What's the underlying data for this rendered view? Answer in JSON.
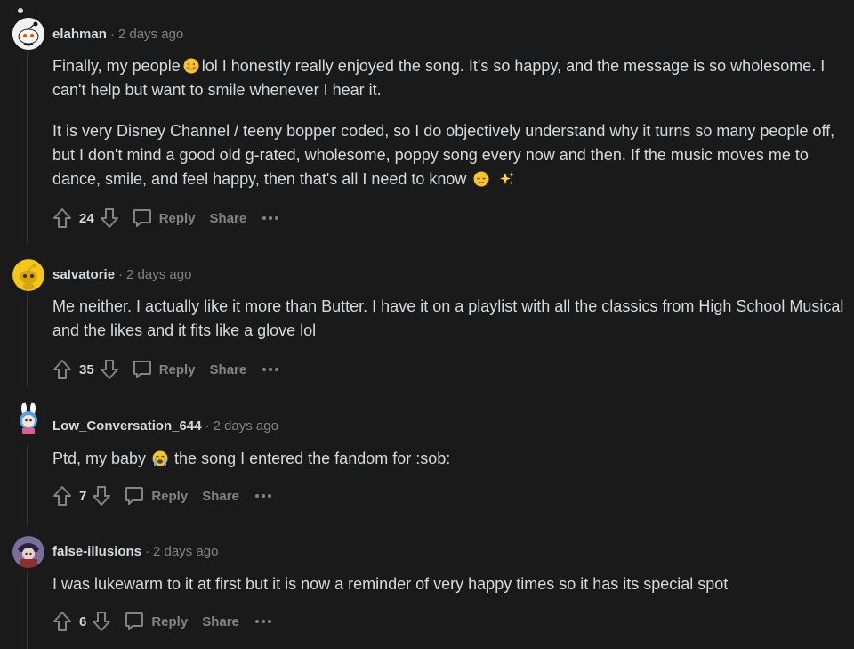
{
  "comments": [
    {
      "username": "elahman",
      "time": "2 days ago",
      "avatar_icon": "reddit-snoo-icon",
      "paragraphs": [
        {
          "before": "Finally, my people",
          "emoji": "grinning-face-emoji",
          "after": "lol I honestly really enjoyed the song. It's so happy, and the message is so wholesome. I can't help but want to smile whenever I hear it."
        },
        {
          "before": "It is very Disney Channel / teeny bopper coded, so I do objectively understand why it turns so many people off, but I don't mind a good old g-rated, wholesome, poppy song every now and then. If the music moves me to dance, smile, and feel happy, then that's all I need to know",
          "emoji": "relieved-face-emoji",
          "emoji2": "sparkles-emoji"
        }
      ],
      "votes": "24",
      "reply": "Reply",
      "share": "Share"
    },
    {
      "username": "saIvatorie",
      "time": "2 days ago",
      "avatar_icon": "yellow-snoo-icon",
      "paragraphs": [
        {
          "before": "Me neither. I actually like it more than Butter. I have it on a playlist with all the classics from High School Musical and the likes and it fits like a glove lol"
        }
      ],
      "votes": "35",
      "reply": "Reply",
      "share": "Share"
    },
    {
      "username": "Low_Conversation_644",
      "time": "2 days ago",
      "avatar_icon": "bunny-avatar-icon",
      "paragraphs": [
        {
          "before": "Ptd, my baby",
          "emoji": "loudly-crying-face-emoji",
          "after": "the song I entered the fandom for :sob:"
        }
      ],
      "votes": "7",
      "reply": "Reply",
      "share": "Share"
    },
    {
      "username": "false-illusions",
      "time": "2 days ago",
      "avatar_icon": "illusion-avatar-icon",
      "paragraphs": [
        {
          "before": "I was lukewarm to it at first but it is now a reminder of very happy times so it has its special spot"
        }
      ],
      "votes": "6",
      "reply": "Reply",
      "share": "Share"
    }
  ],
  "colors": {
    "background": "#1a1a1b",
    "text": "#d7dadc",
    "muted": "#818384",
    "thread_line": "#343536"
  }
}
